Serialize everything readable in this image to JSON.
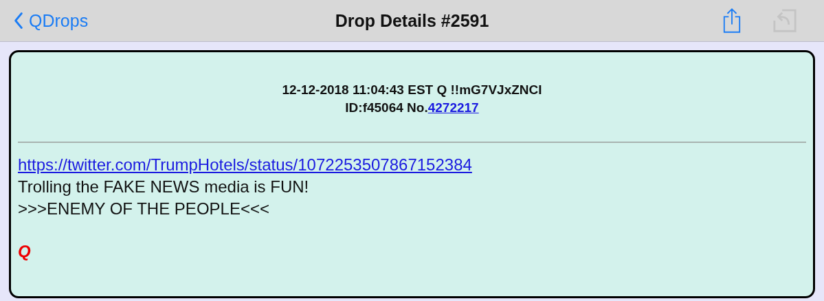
{
  "nav_bar": {
    "back_label": "QDrops",
    "title": "Drop Details #2591",
    "actions": [
      {
        "kind": "share",
        "disabled": false
      },
      {
        "kind": "reply",
        "disabled": true
      }
    ]
  },
  "drop": {
    "header_line": "12-12-2018 11:04:43 EST Q !!mG7VJxZNCI",
    "id_label": "ID:f45064 No.",
    "post_number": "4272217",
    "body": [
      {
        "kind": "link",
        "text": "https://twitter.com/TrumpHotels/status/1072253507867152384"
      },
      {
        "kind": "text",
        "text": "Trolling the FAKE NEWS media is FUN!"
      },
      {
        "kind": "text",
        "text": ">>>ENEMY OF THE PEOPLE<<<"
      }
    ],
    "signature": "Q"
  }
}
